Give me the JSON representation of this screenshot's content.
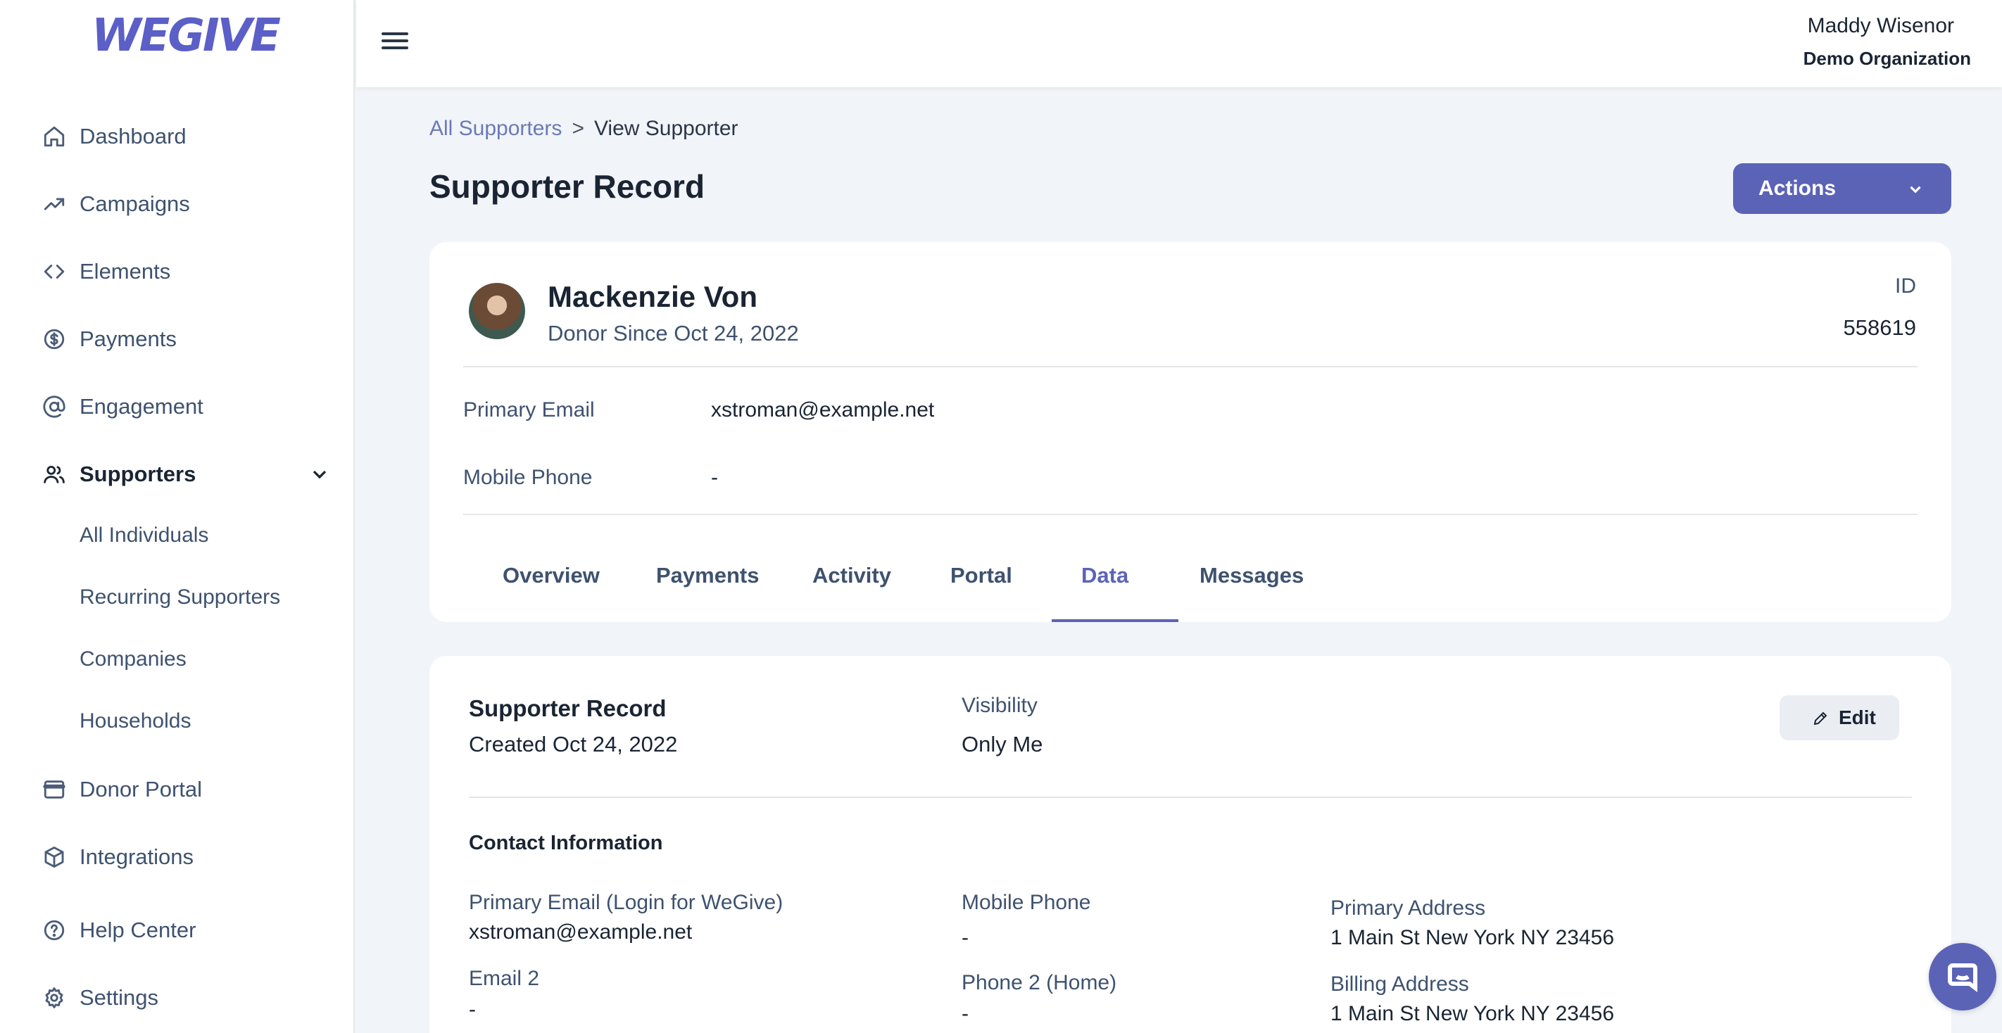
{
  "brand": {
    "logo_text": "WEGIVE",
    "accent_color": "#5b63b7"
  },
  "sidebar": {
    "items": [
      {
        "label": "Dashboard",
        "icon": "home-icon"
      },
      {
        "label": "Campaigns",
        "icon": "trending-up-icon"
      },
      {
        "label": "Elements",
        "icon": "code-icon"
      },
      {
        "label": "Payments",
        "icon": "dollar-circle-icon"
      },
      {
        "label": "Engagement",
        "icon": "at-sign-icon"
      },
      {
        "label": "Supporters",
        "icon": "users-icon",
        "active": true,
        "expanded": true
      },
      {
        "label": "Donor Portal",
        "icon": "browser-window-icon"
      },
      {
        "label": "Integrations",
        "icon": "cube-icon"
      },
      {
        "label": "Help Center",
        "icon": "help-circle-icon"
      },
      {
        "label": "Settings",
        "icon": "gear-icon"
      }
    ],
    "supporters_subitems": [
      "All Individuals",
      "Recurring Supporters",
      "Companies",
      "Households"
    ]
  },
  "topbar": {
    "user_name": "Maddy Wisenor",
    "organization": "Demo Organization"
  },
  "breadcrumb": {
    "parent": "All Supporters",
    "separator": ">",
    "current": "View Supporter"
  },
  "page": {
    "title": "Supporter Record",
    "actions_label": "Actions"
  },
  "supporter": {
    "name": "Mackenzie Von",
    "since": "Donor Since Oct 24, 2022",
    "id_label": "ID",
    "id_value": "558619",
    "primary_email_label": "Primary Email",
    "primary_email": "xstroman@example.net",
    "mobile_phone_label": "Mobile Phone",
    "mobile_phone": "-"
  },
  "tabs": [
    {
      "label": "Overview"
    },
    {
      "label": "Payments"
    },
    {
      "label": "Activity"
    },
    {
      "label": "Portal"
    },
    {
      "label": "Data",
      "active": true
    },
    {
      "label": "Messages"
    }
  ],
  "record": {
    "title": "Supporter Record",
    "created": "Created Oct 24, 2022",
    "visibility_label": "Visibility",
    "visibility_value": "Only Me",
    "edit_label": "Edit"
  },
  "contact": {
    "title": "Contact Information",
    "primary_email_label": "Primary Email (Login for WeGive)",
    "primary_email": "xstroman@example.net",
    "email2_label": "Email 2",
    "email2": "-",
    "mobile_label": "Mobile Phone",
    "mobile": "-",
    "phone2_label": "Phone 2 (Home)",
    "phone2": "-",
    "primary_address_label": "Primary Address",
    "primary_address": "1 Main St New York NY 23456",
    "billing_address_label": "Billing Address",
    "billing_address": "1 Main St New York NY 23456"
  }
}
